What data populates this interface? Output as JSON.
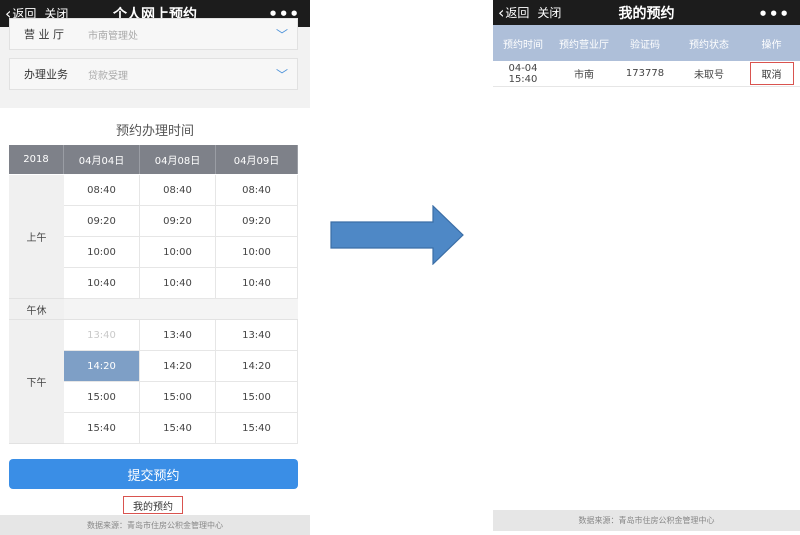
{
  "left": {
    "nav": {
      "back_label": "返回",
      "close_label": "关闭",
      "title": "个人网上预约",
      "more_label": "•••"
    },
    "hall": {
      "label": "营 业 厅",
      "value": "市南管理处"
    },
    "business": {
      "label": "办理业务",
      "value": "贷款受理"
    },
    "schedule": {
      "title": "预约办理时间",
      "year": "2018",
      "dates": [
        "04月04日",
        "04月08日",
        "04月09日"
      ],
      "morning_label": "上午",
      "noon_label": "午休",
      "afternoon_label": "下午",
      "morning_slots": [
        [
          "08:40",
          "08:40",
          "08:40"
        ],
        [
          "09:20",
          "09:20",
          "09:20"
        ],
        [
          "10:00",
          "10:00",
          "10:00"
        ],
        [
          "10:40",
          "10:40",
          "10:40"
        ]
      ],
      "afternoon_slots": [
        [
          "13:40",
          "13:40",
          "13:40"
        ],
        [
          "14:20",
          "14:20",
          "14:20"
        ],
        [
          "15:00",
          "15:00",
          "15:00"
        ],
        [
          "15:40",
          "15:40",
          "15:40"
        ]
      ]
    },
    "submit_label": "提交预约",
    "my_booking_label": "我的预约",
    "footer": "数据来源：青岛市住房公积金管理中心"
  },
  "right": {
    "nav": {
      "back_label": "返回",
      "close_label": "关闭",
      "title": "我的预约",
      "more_label": "•••"
    },
    "table": {
      "headers": [
        "预约时间",
        "预约营业厅",
        "验证码",
        "预约状态",
        "操作"
      ],
      "row": {
        "time": "04-04 15:40",
        "hall": "市南",
        "code": "173778",
        "status": "未取号",
        "action": "取消"
      }
    },
    "footer": "数据来源：青岛市住房公积金管理中心"
  },
  "colors": {
    "nav_bg": "#1c1c1c",
    "header_gray": "#7e8189",
    "selected": "#7e9fc6",
    "submit_blue": "#3a8ee6",
    "table_head": "#aebfd9",
    "highlight_red": "#d9534f",
    "arrow_blue": "#4e88c6"
  }
}
